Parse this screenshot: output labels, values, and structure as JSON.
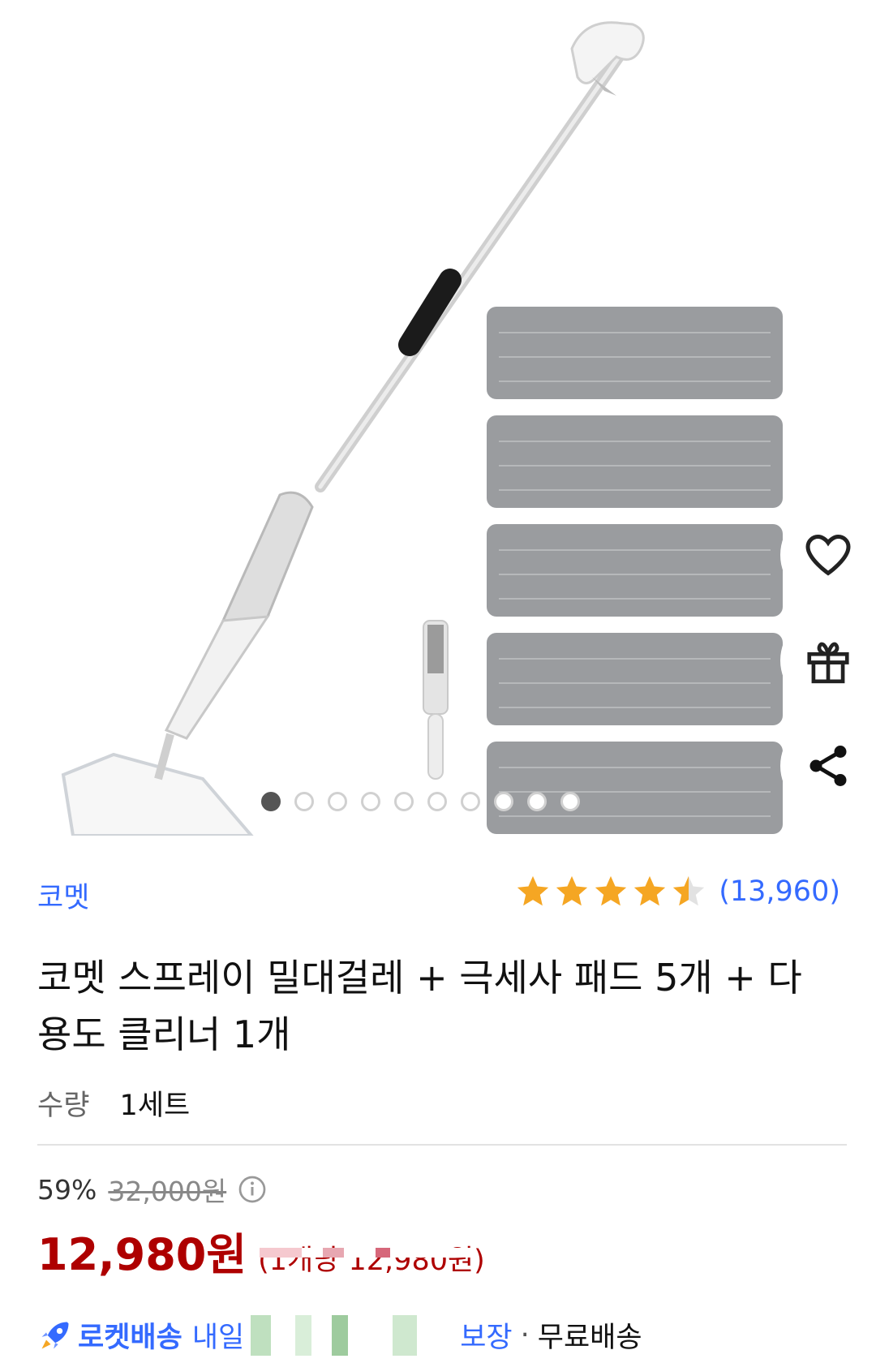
{
  "gallery": {
    "dot_count": 10,
    "active_index": 0,
    "actions": {
      "wishlist_icon": "heart-icon",
      "gift_icon": "gift-icon",
      "share_icon": "share-icon"
    }
  },
  "product": {
    "brand": "코멧",
    "rating_value": 4.5,
    "rating_max": 5,
    "review_count": "(13,960)",
    "title": "코멧 스프레이 밀대걸레 + 극세사 패드 5개 + 다용도 클리너 1개",
    "quantity_label": "수량",
    "quantity_value": "1세트"
  },
  "price": {
    "discount": "59%",
    "original": "32,000원",
    "sale": "12,980원",
    "unit_price": "(1개당 12,980원)"
  },
  "delivery": {
    "icon": "rocket-icon",
    "rocket_label": "로켓배송",
    "day_label": "내일",
    "guarantee_label": "보장",
    "separator": "·",
    "free_shipping": "무료배송"
  },
  "colors": {
    "accent_blue": "#346aff",
    "price_red": "#ae0000",
    "star": "#f5a623"
  }
}
